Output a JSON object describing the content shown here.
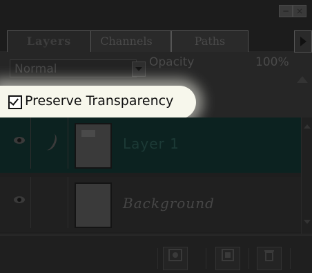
{
  "panel": {
    "window_controls": {
      "minimize_symbol": "−",
      "close_symbol": "×"
    },
    "tabs": [
      {
        "label": "Layers",
        "active": true
      },
      {
        "label": "Channels",
        "active": false
      },
      {
        "label": "Paths",
        "active": false
      }
    ],
    "blend_mode": {
      "value": "Normal"
    },
    "opacity": {
      "label": "Opacity",
      "value": "100%"
    },
    "preserve_transparency": {
      "label": "Preserve Transparency",
      "checked": true
    },
    "layers": [
      {
        "name": "Layer 1",
        "selected": true,
        "visible": true,
        "brush": true
      },
      {
        "name": "Background",
        "selected": false,
        "visible": true,
        "brush": false
      }
    ],
    "bottom_icons": [
      "mask-icon",
      "new-layer-icon",
      "trash-icon"
    ],
    "colors": {
      "selected_layer": "#0c2220",
      "highlight": "#f7f7ec"
    }
  }
}
